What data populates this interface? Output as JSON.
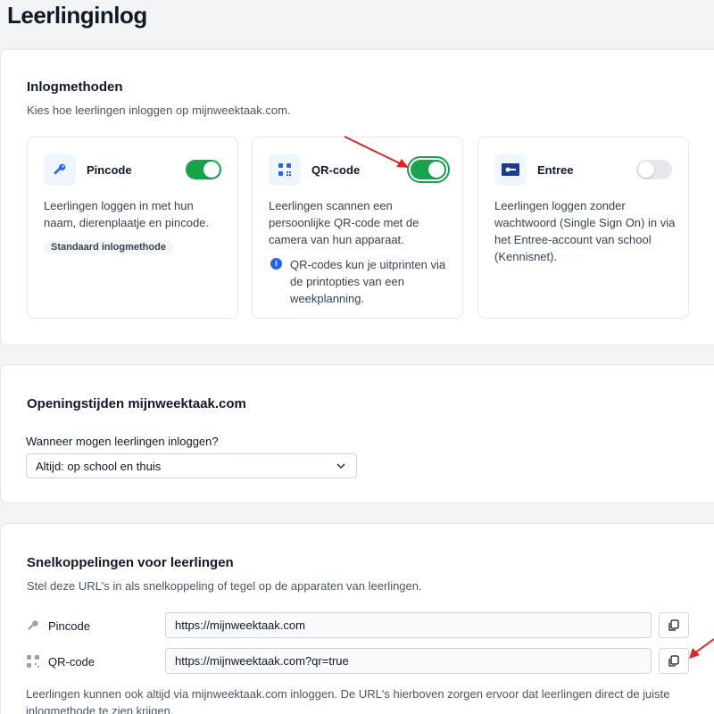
{
  "page": {
    "title": "Leerlinginlog"
  },
  "login_methods": {
    "title": "Inlogmethoden",
    "description": "Kies hoe leerlingen inloggen op mijnweektaak.com.",
    "methods": [
      {
        "name": "Pincode",
        "icon": "key-icon",
        "enabled": true,
        "description": "Leerlingen loggen in met hun naam, dierenplaatje en pincode.",
        "badge": "Standaard inlogmethode"
      },
      {
        "name": "QR-code",
        "icon": "qr-code-icon",
        "enabled": true,
        "description": "Leerlingen scannen een persoonlijke QR-code met de camera van hun apparaat.",
        "info": "QR-codes kun je uitprinten via de printopties van een weekplanning."
      },
      {
        "name": "Entree",
        "icon": "entree-logo-icon",
        "enabled": false,
        "description": "Leerlingen loggen zonder wachtwoord (Single Sign On) in via het Entree-account van school (Kennisnet)."
      }
    ]
  },
  "opening_hours": {
    "title": "Openingstijden mijnweektaak.com",
    "question": "Wanneer mogen leerlingen inloggen?",
    "selected": "Altijd: op school en thuis"
  },
  "shortcuts": {
    "title": "Snelkoppelingen voor leerlingen",
    "description": "Stel deze URL's in als snelkoppeling of tegel op de apparaten van leerlingen.",
    "rows": [
      {
        "label": "Pincode",
        "icon": "key-icon",
        "url": "https://mijnweektaak.com"
      },
      {
        "label": "QR-code",
        "icon": "qr-code-icon",
        "url": "https://mijnweektaak.com?qr=true"
      }
    ],
    "footer": "Leerlingen kunnen ook altijd via mijnweektaak.com inloggen. De URL's hierboven zorgen ervoor dat leerlingen direct de juiste inlogmethode te zien krijgen."
  },
  "colors": {
    "toggle_on": "#16a34a",
    "accent_blue": "#2563eb",
    "annotation_arrow": "#dc2626"
  }
}
